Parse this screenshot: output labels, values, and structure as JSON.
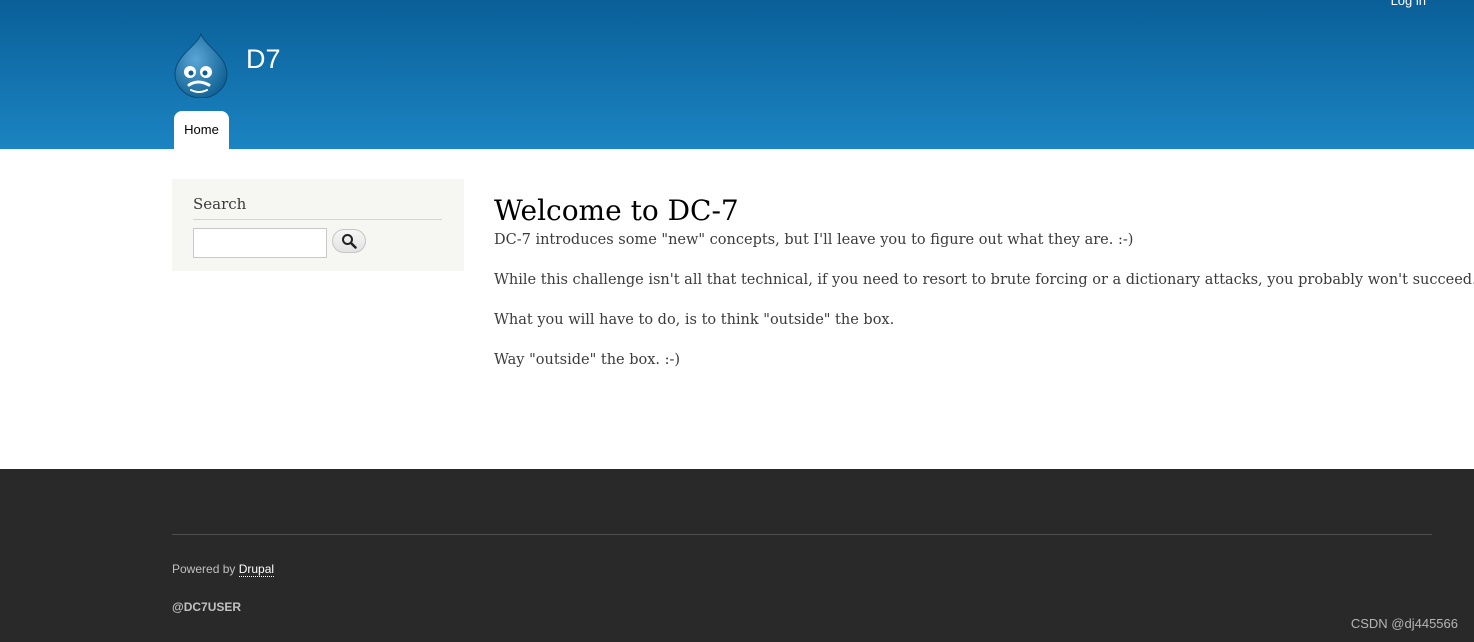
{
  "header": {
    "login_label": "Log in",
    "site_name": "D7",
    "logo_icon": "drupal-drop-icon",
    "nav": {
      "home_label": "Home"
    },
    "colors": {
      "top": "#0a5f98",
      "bottom": "#1b84c2"
    }
  },
  "sidebar": {
    "search_block": {
      "title": "Search",
      "input_value": "",
      "button_icon": "search-icon"
    }
  },
  "main": {
    "title": "Welcome to DC-7",
    "paragraphs": [
      "DC-7 introduces some \"new\" concepts, but I'll leave you to figure out what they are.  :-)",
      "While this challenge isn't all that technical, if you need to resort to brute forcing or a dictionary attacks, you probably won't succeed.",
      "What you will have to do, is to think \"outside\" the box.",
      "Way \"outside\" the box.  :-)"
    ]
  },
  "footer": {
    "powered_prefix": "Powered by ",
    "powered_link": "Drupal",
    "user_text": "@DC7USER",
    "background": "#292929"
  },
  "watermark": "CSDN @dj445566"
}
